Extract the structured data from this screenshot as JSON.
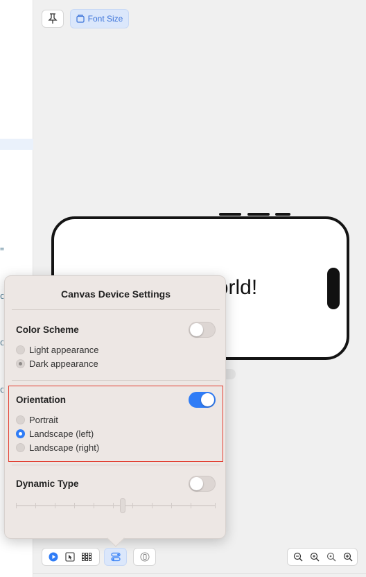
{
  "toolbar": {
    "pin_icon": "pin-icon",
    "font_size_label": "Font Size"
  },
  "preview": {
    "text": "Hello, World!"
  },
  "popover": {
    "title": "Canvas Device Settings",
    "color_scheme": {
      "title": "Color Scheme",
      "enabled": false,
      "options": [
        "Light appearance",
        "Dark appearance"
      ],
      "selected": "Dark appearance"
    },
    "orientation": {
      "title": "Orientation",
      "enabled": true,
      "options": [
        "Portrait",
        "Landscape (left)",
        "Landscape (right)"
      ],
      "selected": "Landscape (left)"
    },
    "dynamic_type": {
      "title": "Dynamic Type",
      "enabled": false,
      "slider_level": 0.5
    }
  },
  "bottom_bar": {
    "mode_icons": [
      "live-preview-icon",
      "selectable-icon",
      "variants-grid-icon"
    ],
    "settings_icon": "device-settings-icon",
    "device_icon": "device-icon",
    "zoom_icons": [
      "zoom-out-icon",
      "zoom-fit-icon",
      "zoom-100-icon",
      "zoom-in-icon"
    ]
  },
  "colors": {
    "accent": "#2f7cf6",
    "highlight_border": "#e23b2e",
    "popover_bg": "#ede7e4"
  }
}
